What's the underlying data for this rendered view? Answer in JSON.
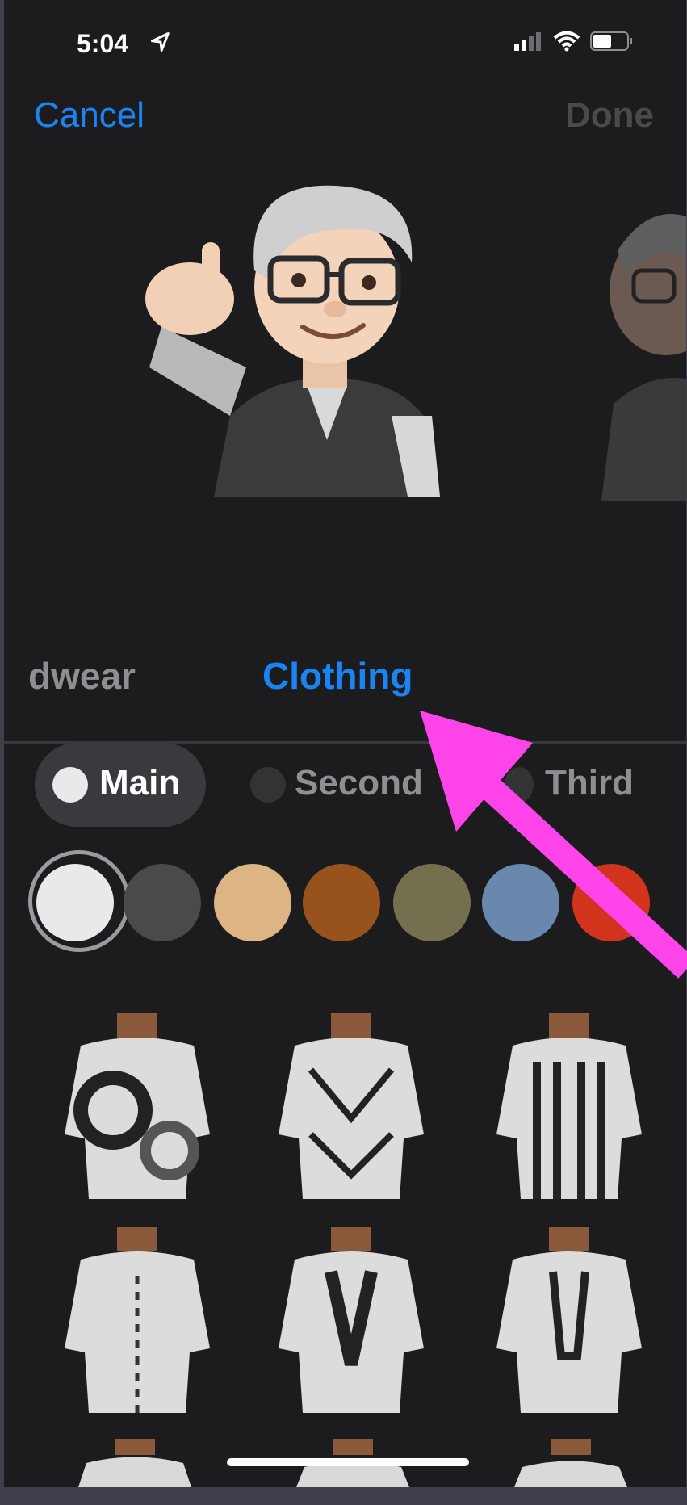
{
  "status_bar": {
    "time": "5:04"
  },
  "nav": {
    "cancel": "Cancel",
    "done": "Done"
  },
  "category_tabs": {
    "previous": "dwear",
    "active": "Clothing"
  },
  "color_slots": {
    "main": "Main",
    "second": "Second",
    "third": "Third"
  },
  "swatches": [
    "#e9e9ea",
    "#4a4a4d",
    "#ddb483",
    "#98531d",
    "#74704f",
    "#6a88ad",
    "#d2331c"
  ],
  "colors": {
    "accent": "#1b84f5",
    "annotation_arrow": "#ff44ea"
  },
  "outfits": [
    {
      "icon": "clothing-patterned-dress-icon"
    },
    {
      "icon": "clothing-lattice-tunic-icon"
    },
    {
      "icon": "clothing-striped-dress-icon"
    },
    {
      "icon": "clothing-hooded-robe-icon"
    },
    {
      "icon": "clothing-dashiki-icon"
    },
    {
      "icon": "clothing-kaftan-icon"
    }
  ]
}
